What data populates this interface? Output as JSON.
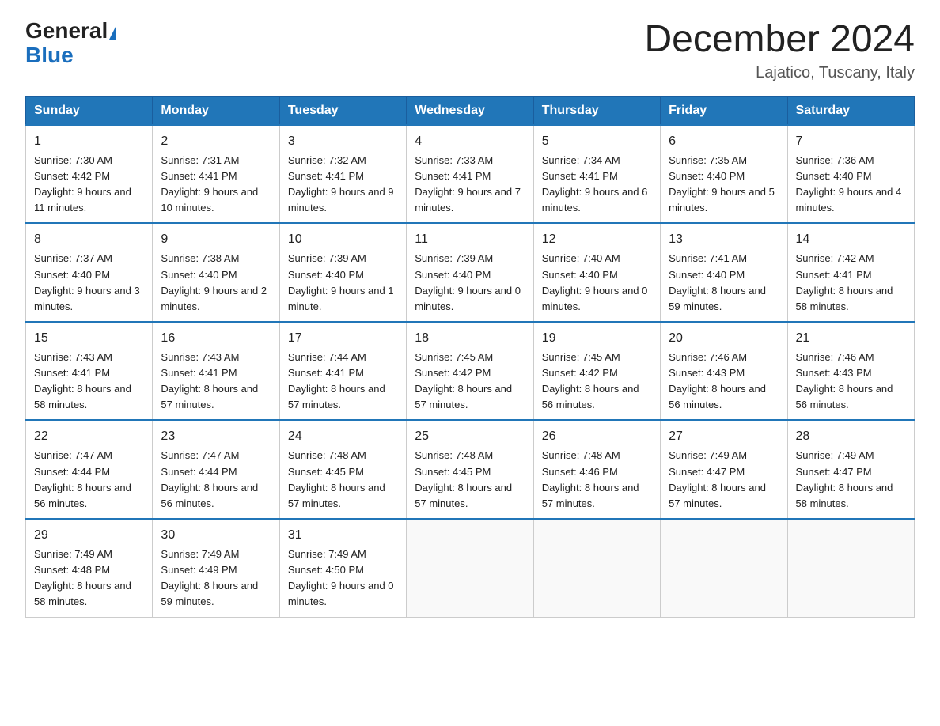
{
  "logo": {
    "general": "General",
    "blue": "Blue",
    "triangle": "▶"
  },
  "header": {
    "month": "December 2024",
    "location": "Lajatico, Tuscany, Italy"
  },
  "days_of_week": [
    "Sunday",
    "Monday",
    "Tuesday",
    "Wednesday",
    "Thursday",
    "Friday",
    "Saturday"
  ],
  "weeks": [
    [
      {
        "day": "1",
        "sunrise": "7:30 AM",
        "sunset": "4:42 PM",
        "daylight": "9 hours and 11 minutes."
      },
      {
        "day": "2",
        "sunrise": "7:31 AM",
        "sunset": "4:41 PM",
        "daylight": "9 hours and 10 minutes."
      },
      {
        "day": "3",
        "sunrise": "7:32 AM",
        "sunset": "4:41 PM",
        "daylight": "9 hours and 9 minutes."
      },
      {
        "day": "4",
        "sunrise": "7:33 AM",
        "sunset": "4:41 PM",
        "daylight": "9 hours and 7 minutes."
      },
      {
        "day": "5",
        "sunrise": "7:34 AM",
        "sunset": "4:41 PM",
        "daylight": "9 hours and 6 minutes."
      },
      {
        "day": "6",
        "sunrise": "7:35 AM",
        "sunset": "4:40 PM",
        "daylight": "9 hours and 5 minutes."
      },
      {
        "day": "7",
        "sunrise": "7:36 AM",
        "sunset": "4:40 PM",
        "daylight": "9 hours and 4 minutes."
      }
    ],
    [
      {
        "day": "8",
        "sunrise": "7:37 AM",
        "sunset": "4:40 PM",
        "daylight": "9 hours and 3 minutes."
      },
      {
        "day": "9",
        "sunrise": "7:38 AM",
        "sunset": "4:40 PM",
        "daylight": "9 hours and 2 minutes."
      },
      {
        "day": "10",
        "sunrise": "7:39 AM",
        "sunset": "4:40 PM",
        "daylight": "9 hours and 1 minute."
      },
      {
        "day": "11",
        "sunrise": "7:39 AM",
        "sunset": "4:40 PM",
        "daylight": "9 hours and 0 minutes."
      },
      {
        "day": "12",
        "sunrise": "7:40 AM",
        "sunset": "4:40 PM",
        "daylight": "9 hours and 0 minutes."
      },
      {
        "day": "13",
        "sunrise": "7:41 AM",
        "sunset": "4:40 PM",
        "daylight": "8 hours and 59 minutes."
      },
      {
        "day": "14",
        "sunrise": "7:42 AM",
        "sunset": "4:41 PM",
        "daylight": "8 hours and 58 minutes."
      }
    ],
    [
      {
        "day": "15",
        "sunrise": "7:43 AM",
        "sunset": "4:41 PM",
        "daylight": "8 hours and 58 minutes."
      },
      {
        "day": "16",
        "sunrise": "7:43 AM",
        "sunset": "4:41 PM",
        "daylight": "8 hours and 57 minutes."
      },
      {
        "day": "17",
        "sunrise": "7:44 AM",
        "sunset": "4:41 PM",
        "daylight": "8 hours and 57 minutes."
      },
      {
        "day": "18",
        "sunrise": "7:45 AM",
        "sunset": "4:42 PM",
        "daylight": "8 hours and 57 minutes."
      },
      {
        "day": "19",
        "sunrise": "7:45 AM",
        "sunset": "4:42 PM",
        "daylight": "8 hours and 56 minutes."
      },
      {
        "day": "20",
        "sunrise": "7:46 AM",
        "sunset": "4:43 PM",
        "daylight": "8 hours and 56 minutes."
      },
      {
        "day": "21",
        "sunrise": "7:46 AM",
        "sunset": "4:43 PM",
        "daylight": "8 hours and 56 minutes."
      }
    ],
    [
      {
        "day": "22",
        "sunrise": "7:47 AM",
        "sunset": "4:44 PM",
        "daylight": "8 hours and 56 minutes."
      },
      {
        "day": "23",
        "sunrise": "7:47 AM",
        "sunset": "4:44 PM",
        "daylight": "8 hours and 56 minutes."
      },
      {
        "day": "24",
        "sunrise": "7:48 AM",
        "sunset": "4:45 PM",
        "daylight": "8 hours and 57 minutes."
      },
      {
        "day": "25",
        "sunrise": "7:48 AM",
        "sunset": "4:45 PM",
        "daylight": "8 hours and 57 minutes."
      },
      {
        "day": "26",
        "sunrise": "7:48 AM",
        "sunset": "4:46 PM",
        "daylight": "8 hours and 57 minutes."
      },
      {
        "day": "27",
        "sunrise": "7:49 AM",
        "sunset": "4:47 PM",
        "daylight": "8 hours and 57 minutes."
      },
      {
        "day": "28",
        "sunrise": "7:49 AM",
        "sunset": "4:47 PM",
        "daylight": "8 hours and 58 minutes."
      }
    ],
    [
      {
        "day": "29",
        "sunrise": "7:49 AM",
        "sunset": "4:48 PM",
        "daylight": "8 hours and 58 minutes."
      },
      {
        "day": "30",
        "sunrise": "7:49 AM",
        "sunset": "4:49 PM",
        "daylight": "8 hours and 59 minutes."
      },
      {
        "day": "31",
        "sunrise": "7:49 AM",
        "sunset": "4:50 PM",
        "daylight": "9 hours and 0 minutes."
      },
      null,
      null,
      null,
      null
    ]
  ],
  "labels": {
    "sunrise": "Sunrise:",
    "sunset": "Sunset:",
    "daylight": "Daylight:"
  }
}
